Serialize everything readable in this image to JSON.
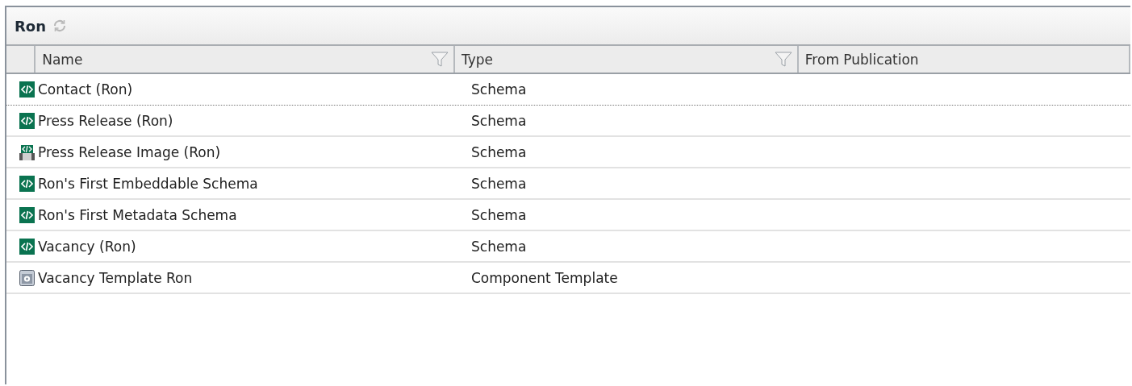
{
  "panel": {
    "title": "Ron"
  },
  "table": {
    "columns": [
      {
        "label": "Name",
        "filter": true
      },
      {
        "label": "Type",
        "filter": true
      },
      {
        "label": "From Publication",
        "filter": false
      }
    ],
    "rows": [
      {
        "kind": "schema",
        "name": "Contact (Ron)",
        "type": "Schema",
        "focused": true
      },
      {
        "kind": "schema",
        "name": "Press Release (Ron)",
        "type": "Schema",
        "focused": false
      },
      {
        "kind": "multimedia-schema",
        "name": "Press Release Image (Ron)",
        "type": "Schema",
        "focused": false
      },
      {
        "kind": "schema",
        "name": "Ron's First Embeddable Schema",
        "type": "Schema",
        "focused": false
      },
      {
        "kind": "schema",
        "name": "Ron's First Metadata Schema",
        "type": "Schema",
        "focused": false
      },
      {
        "kind": "schema",
        "name": "Vacancy (Ron)",
        "type": "Schema",
        "focused": false
      },
      {
        "kind": "template",
        "name": "Vacancy Template Ron",
        "type": "Component Template",
        "focused": false
      }
    ]
  }
}
